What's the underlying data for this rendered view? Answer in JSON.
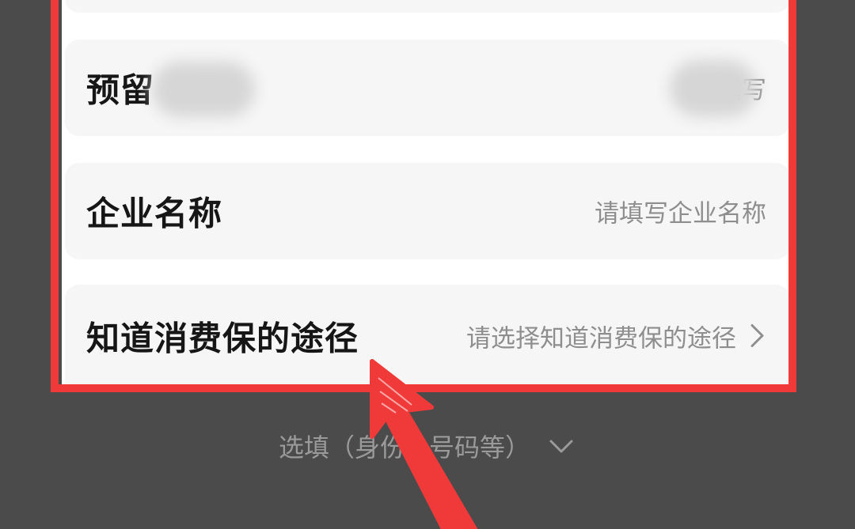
{
  "form": {
    "rows": [
      {
        "label": "预留",
        "placeholder": "请填写"
      },
      {
        "label": "企业名称",
        "placeholder": "请填写企业名称"
      },
      {
        "label": "知道消费保的途径",
        "placeholder": "请选择知道消费保的途径",
        "icon": "chevron-right-icon"
      }
    ]
  },
  "optional": {
    "label": "选填（身份",
    "label_tail": "号码等）",
    "icon": "chevron-down-icon"
  },
  "colors": {
    "highlight": "#f03a3a",
    "background": "#4b4b4b",
    "row_background": "#f6f6f6",
    "label_text": "#161616",
    "placeholder_text": "#8e8e8e"
  }
}
